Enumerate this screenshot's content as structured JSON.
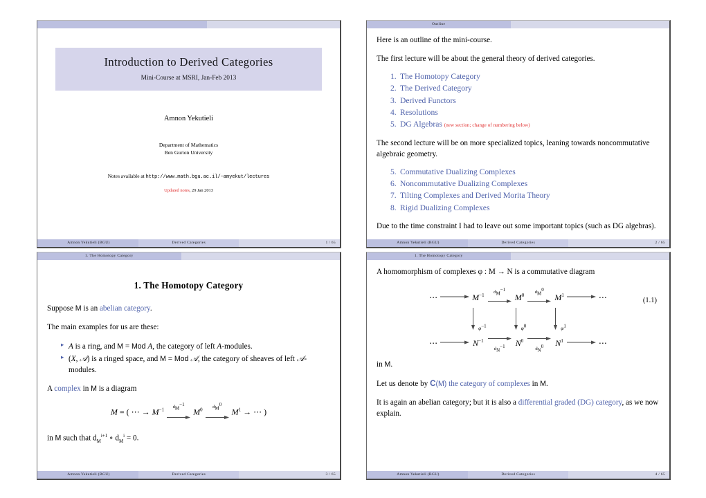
{
  "document": {
    "kind": "beamer-handout-4up",
    "page_background": "#ffffff",
    "accent_dark": "#bcc0e0",
    "accent_mid": "#c9cce6",
    "accent_light": "#d7d9ea",
    "title_box_bg": "#d6d5eb",
    "link_blue": "#4f62ab",
    "alert_red": "#e02b2b"
  },
  "slides": [
    {
      "id": "slide-1",
      "header_title": "",
      "title": "Introduction to Derived Categories",
      "subtitle": "Mini-Course at MSRI, Jan-Feb 2013",
      "author": "Amnon Yekutieli",
      "affiliation_line1": "Department of Mathematics",
      "affiliation_line2": "Ben Gurion University",
      "notes_prefix": "Notes available at ",
      "notes_url": "http://www.math.bgu.ac.il/~amyekut/lectures",
      "updated_label": "Updated notes",
      "updated_date": ", 29 Jan 2013",
      "footer": {
        "author": "Amnon Yekutieli  (BGU)",
        "title": "Derived Categories",
        "page": "1 / 65"
      }
    },
    {
      "id": "slide-2",
      "header_title": "Outline",
      "para1": "Here is an outline of the mini-course.",
      "para2": "The first lecture will be about the general theory of derived categories.",
      "list1": [
        {
          "num": "1.",
          "label": "The Homotopy Category",
          "note": ""
        },
        {
          "num": "2.",
          "label": "The Derived Category",
          "note": ""
        },
        {
          "num": "3.",
          "label": "Derived Functors",
          "note": ""
        },
        {
          "num": "4.",
          "label": "Resolutions",
          "note": ""
        },
        {
          "num": "5.",
          "label": "DG Algebras",
          "note": "(new section; change of numbering below)"
        }
      ],
      "para3": "The second lecture will be on more specialized topics, leaning towards noncommutative algebraic geometry.",
      "list2": [
        {
          "num": "5.",
          "label": "Commutative Dualizing Complexes",
          "note": ""
        },
        {
          "num": "6.",
          "label": "Noncommutative Dualizing Complexes",
          "note": ""
        },
        {
          "num": "7.",
          "label": "Tilting Complexes and Derived Morita Theory",
          "note": ""
        },
        {
          "num": "8.",
          "label": "Rigid Dualizing Complexes",
          "note": ""
        }
      ],
      "para4": "Due to the time constraint I had to leave out some important topics (such as DG algebras).",
      "footer": {
        "author": "Amnon Yekutieli  (BGU)",
        "title": "Derived Categories",
        "page": "2 / 65"
      }
    },
    {
      "id": "slide-3",
      "header_title": "1. The Homotopy Category",
      "section_heading": "1. The Homotopy Category",
      "para1_pre": "Suppose ",
      "para1_sf": "M",
      "para1_mid": " is an ",
      "para1_link": "abelian category",
      "para1_post": ".",
      "para2": "The main examples for us are these:",
      "bullets": [
        "A is a ring, and M = Mod A, the category of left A-modules.",
        "(X, A) is a ringed space, and M = Mod A, the category of sheaves of left A-modules."
      ],
      "para3_pre": "A ",
      "para3_link": "complex",
      "para3_mid": " in ",
      "para3_sf": "M",
      "para3_post": " is a diagram",
      "display_math": "M = ( ⋯ → M^{-1} --d_M^{-1}--> M^0 --d_M^0--> M^1 → ⋯ )",
      "para4": "in M such that d_M^{i+1} ∘ d_M^i = 0.",
      "footer": {
        "author": "Amnon Yekutieli  (BGU)",
        "title": "Derived Categories",
        "page": "3 / 65"
      }
    },
    {
      "id": "slide-4",
      "header_title": "1. The Homotopy Category",
      "para1": "A homomorphism of complexes φ : M → N is a commutative diagram",
      "equation_number": "(1.1)",
      "diagram": {
        "top_row": [
          "⋯",
          "M",
          "M",
          "M",
          "⋯"
        ],
        "bottom_row": [
          "⋯",
          "N",
          "N",
          "N",
          "⋯"
        ],
        "top_arrow_labels": [
          "d_M^{-1}",
          "d_M^{0}"
        ],
        "bottom_arrow_labels": [
          "d_N^{-1}",
          "d_N^{0}"
        ],
        "vertical_labels": [
          "φ^{-1}",
          "φ^{0}",
          "φ^{1}"
        ],
        "superscripts": [
          "-1",
          "0",
          "1"
        ]
      },
      "para2_pre": "in ",
      "para2_sf": "M",
      "para2_post": ".",
      "para3_pre": "Let us denote by ",
      "para3_bold": "C",
      "para3_paren": "(M)",
      "para3_link": " the category of complexes",
      "para3_mid": " in ",
      "para3_sf": "M",
      "para3_post": ".",
      "para4_pre": "It is again an abelian category; but it is also a ",
      "para4_link": "differential graded (DG) category",
      "para4_post": ", as we now explain.",
      "footer": {
        "author": "Amnon Yekutieli  (BGU)",
        "title": "Derived Categories",
        "page": "4 / 65"
      }
    }
  ]
}
